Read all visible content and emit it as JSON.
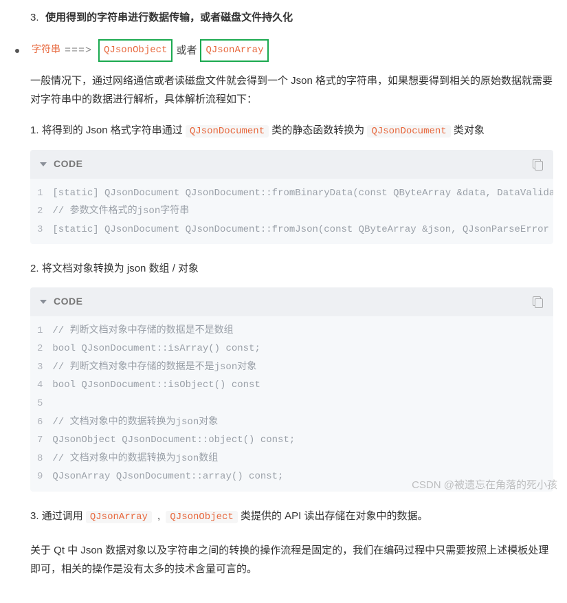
{
  "top_item": {
    "num": "3.",
    "text": "使用得到的字符串进行数据传输，或者磁盘文件持久化"
  },
  "bullet": {
    "str_label": "字符串",
    "arrow": "===>",
    "box1": "QJsonObject",
    "or": "或者",
    "box2": "QJsonArray"
  },
  "intro_para": "一般情况下，通过网络通信或者读磁盘文件就会得到一个 Json 格式的字符串，如果想要得到相关的原始数据就需要对字符串中的数据进行解析，具体解析流程如下：",
  "step1": {
    "pre": "将得到的 Json 格式字符串通过 ",
    "code1": "QJsonDocument",
    "mid": " 类的静态函数转换为 ",
    "code2": "QJsonDocument",
    "post": " 类对象"
  },
  "codeblock1": {
    "title": "CODE",
    "lines": [
      "[static] QJsonDocument QJsonDocument::fromBinaryData(const QByteArray &data, DataValidation",
      "// 参数文件格式的json字符串",
      "[static] QJsonDocument QJsonDocument::fromJson(const QByteArray &json, QJsonParseError *err"
    ]
  },
  "step2": "将文档对象转换为 json 数组 / 对象",
  "codeblock2": {
    "title": "CODE",
    "lines": [
      "// 判断文档对象中存储的数据是不是数组",
      "bool QJsonDocument::isArray() const;",
      "// 判断文档对象中存储的数据是不是json对象",
      "bool QJsonDocument::isObject() const",
      "",
      "// 文档对象中的数据转换为json对象",
      "QJsonObject QJsonDocument::object() const;",
      "// 文档对象中的数据转换为json数组",
      "QJsonArray QJsonDocument::array() const;"
    ]
  },
  "step3": {
    "pre": "通过调用 ",
    "code1": "QJsonArray",
    "comma": " , ",
    "code2": "QJsonObject",
    "post": " 类提供的 API 读出存储在对象中的数据。"
  },
  "closing_para": "关于 Qt 中 Json 数据对象以及字符串之间的转换的操作流程是固定的，我们在编码过程中只需要按照上述模板处理即可，相关的操作是没有太多的技术含量可言的。",
  "watermark": "CSDN @被遗忘在角落的死小孩"
}
